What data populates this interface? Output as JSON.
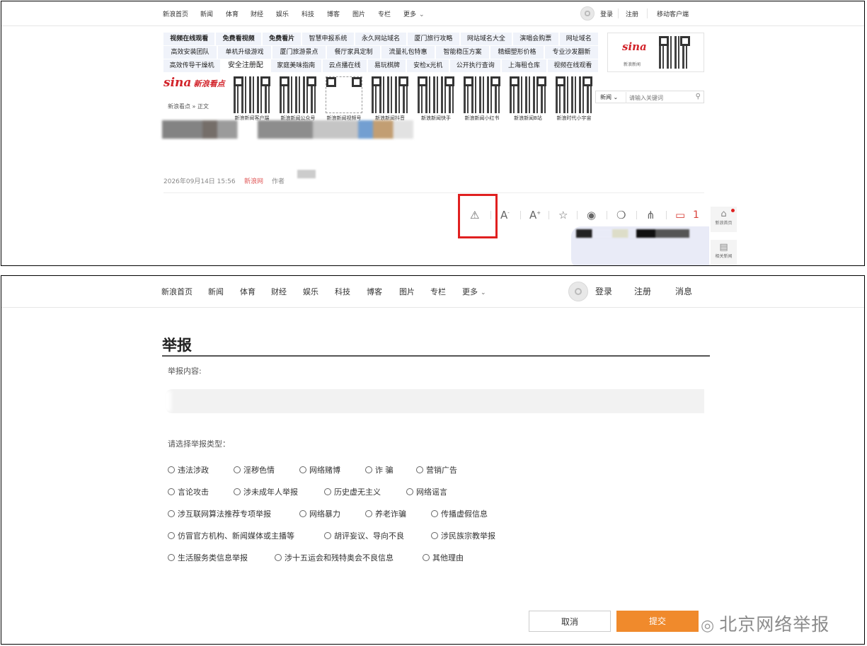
{
  "top_nav": {
    "items": [
      "新浪首页",
      "新闻",
      "体育",
      "财经",
      "娱乐",
      "科技",
      "博客",
      "图片",
      "专栏",
      "更多"
    ],
    "login": "登录",
    "register": "注册",
    "mobile_client": "移动客户端"
  },
  "ads": {
    "row1": [
      "视频在线观看",
      "免费看视频",
      "免费看片",
      "智慧申报系统",
      "永久网站域名",
      "厦门旅行攻略",
      "网站域名大全",
      "演唱会购票",
      "网址域名"
    ],
    "row2": [
      "高效安装团队",
      "单机升级游戏",
      "厦门旅游景点",
      "餐厅家具定制",
      "流量礼包特惠",
      "智能稳压方案",
      "精细塑形价格",
      "专业沙发翻新"
    ],
    "row3": [
      "高效传导干燥机",
      "安全注册配",
      "家庭美味指南",
      "云点播在线",
      "易玩棋牌",
      "安检x光机",
      "公开执行查询",
      "上海租仓库",
      "视频在线观看"
    ]
  },
  "brand": {
    "logo": "sina",
    "logo_sub": "新浪看点",
    "breadcrumb": "新浪看点 » 正文",
    "news_logo_sub": "新浪新闻"
  },
  "qr_codes": [
    "新浪新闻客户端",
    "新浪新闻公众号",
    "新浪新闻视频号",
    "新浪新闻抖音",
    "新浪新闻快手",
    "新浪新闻小红书",
    "新浪新闻B站",
    "新浪时代小宇宙"
  ],
  "search": {
    "category": "新闻",
    "placeholder": "请输入关键词"
  },
  "article": {
    "date": "2026年09月14日 15:56",
    "source": "新浪网",
    "author_label": "作者"
  },
  "toolbar": {
    "comment_count": "1"
  },
  "side": {
    "home": "新浪首页",
    "related": "相关新闻"
  },
  "nav2": {
    "items": [
      "新浪首页",
      "新闻",
      "体育",
      "财经",
      "娱乐",
      "科技",
      "博客",
      "图片",
      "专栏",
      "更多"
    ],
    "login": "登录",
    "register": "注册",
    "messages": "消息"
  },
  "report": {
    "title": "举报",
    "content_label": "举报内容:",
    "type_label": "请选择举报类型：",
    "rows": [
      [
        "违法涉政",
        "淫秽色情",
        "网络赌博",
        "诈 骗",
        "营销广告"
      ],
      [
        "言论攻击",
        "涉未成年人举报",
        "历史虚无主义",
        "网络谣言"
      ],
      [
        "涉互联网算法推荐专项举报",
        "网络暴力",
        "养老诈骗",
        "传播虚假信息"
      ],
      [
        "仿冒官方机构、新闻媒体或主播等",
        "胡评妄议、导向不良",
        "涉民族宗教举报"
      ],
      [
        "生活服务类信息举报",
        "涉十五运会和残特奥会不良信息",
        "其他理由"
      ]
    ],
    "cancel": "取消",
    "submit": "提交"
  },
  "watermark": "北京网络举报",
  "colors": {
    "accent": "#f08a2c",
    "sina_red": "#d2232a",
    "highlight": "#e02020"
  }
}
